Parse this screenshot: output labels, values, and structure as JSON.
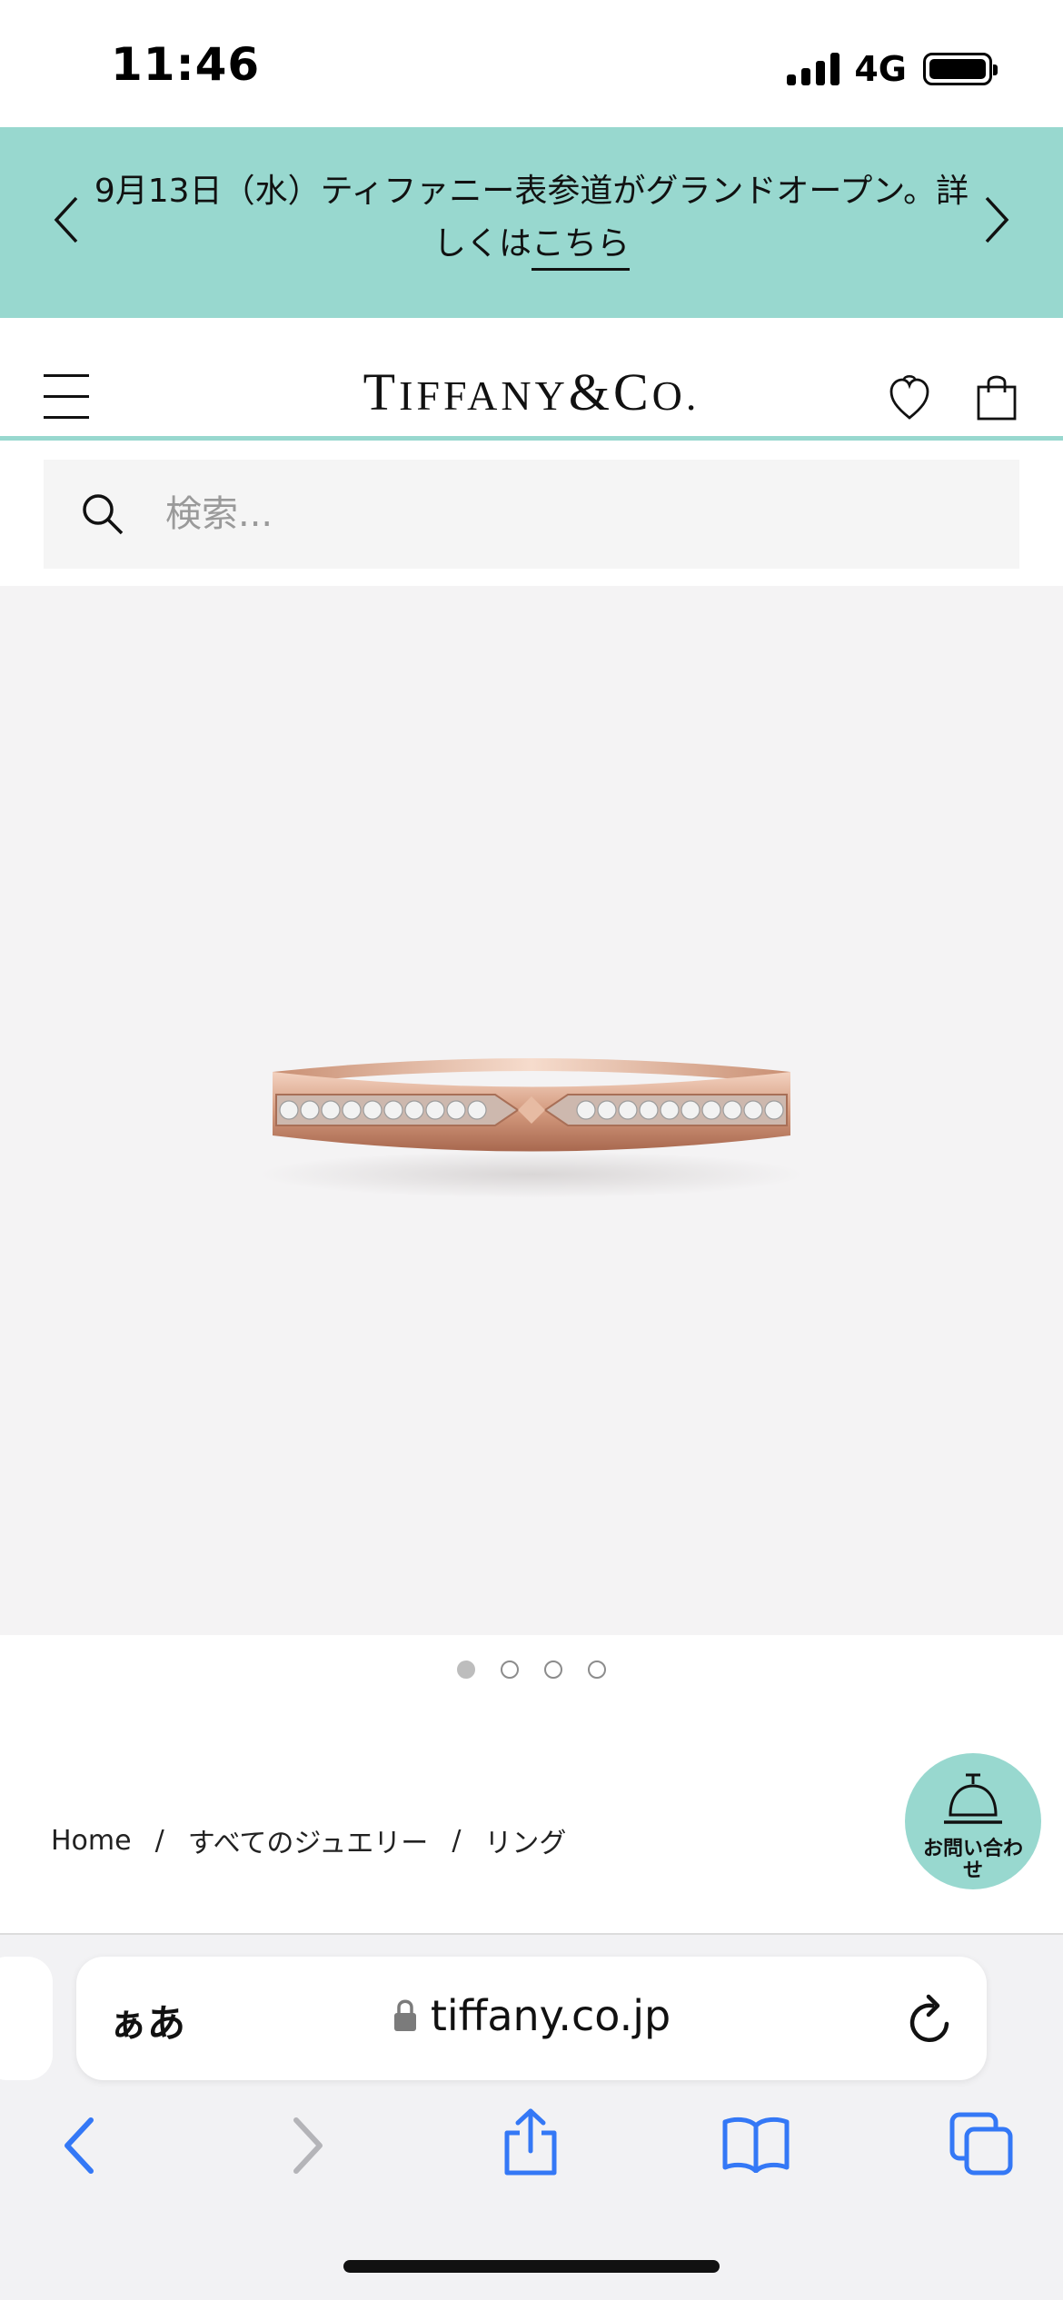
{
  "status_bar": {
    "time": "11:46",
    "network": "4G",
    "battery_level": 0.9
  },
  "banner": {
    "text": "9月13日（水）ティファニー表参道がグランドオープン。詳しくは",
    "link_text": "こちら",
    "background_color": "#98d8cf"
  },
  "header": {
    "logo_T": "T",
    "logo_iffany": "IFFANY",
    "logo_amp": "&",
    "logo_C": "C",
    "logo_o": "O."
  },
  "search": {
    "placeholder": "検索..."
  },
  "carousel": {
    "total": 4,
    "active_index": 0
  },
  "breadcrumb": {
    "items": [
      "Home",
      "すべてのジュエリー",
      "リング"
    ],
    "separator": "/"
  },
  "contact": {
    "label": "お問い合わせ"
  },
  "browser": {
    "aa_label": "ぁあ",
    "url": "tiffany.co.jp",
    "accent_color": "#3478f6"
  }
}
